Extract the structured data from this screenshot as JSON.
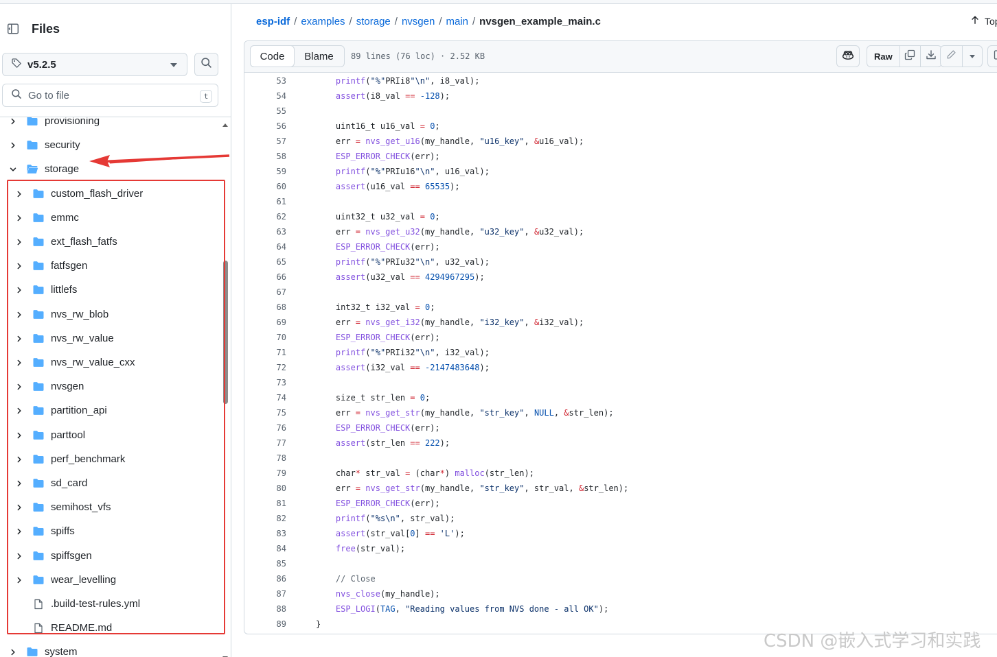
{
  "sidebar": {
    "title": "Files",
    "branch": "v5.2.5",
    "goto_placeholder": "Go to file",
    "goto_shortcut": "t",
    "tree": [
      {
        "label": "provisioning",
        "type": "folder",
        "expanded": false,
        "depth": 0
      },
      {
        "label": "security",
        "type": "folder",
        "expanded": false,
        "depth": 0
      },
      {
        "label": "storage",
        "type": "folder",
        "expanded": true,
        "depth": 0
      },
      {
        "label": "custom_flash_driver",
        "type": "folder",
        "expanded": false,
        "depth": 1
      },
      {
        "label": "emmc",
        "type": "folder",
        "expanded": false,
        "depth": 1
      },
      {
        "label": "ext_flash_fatfs",
        "type": "folder",
        "expanded": false,
        "depth": 1
      },
      {
        "label": "fatfsgen",
        "type": "folder",
        "expanded": false,
        "depth": 1
      },
      {
        "label": "littlefs",
        "type": "folder",
        "expanded": false,
        "depth": 1
      },
      {
        "label": "nvs_rw_blob",
        "type": "folder",
        "expanded": false,
        "depth": 1
      },
      {
        "label": "nvs_rw_value",
        "type": "folder",
        "expanded": false,
        "depth": 1
      },
      {
        "label": "nvs_rw_value_cxx",
        "type": "folder",
        "expanded": false,
        "depth": 1
      },
      {
        "label": "nvsgen",
        "type": "folder",
        "expanded": false,
        "depth": 1
      },
      {
        "label": "partition_api",
        "type": "folder",
        "expanded": false,
        "depth": 1
      },
      {
        "label": "parttool",
        "type": "folder",
        "expanded": false,
        "depth": 1
      },
      {
        "label": "perf_benchmark",
        "type": "folder",
        "expanded": false,
        "depth": 1
      },
      {
        "label": "sd_card",
        "type": "folder",
        "expanded": false,
        "depth": 1
      },
      {
        "label": "semihost_vfs",
        "type": "folder",
        "expanded": false,
        "depth": 1
      },
      {
        "label": "spiffs",
        "type": "folder",
        "expanded": false,
        "depth": 1
      },
      {
        "label": "spiffsgen",
        "type": "folder",
        "expanded": false,
        "depth": 1
      },
      {
        "label": "wear_levelling",
        "type": "folder",
        "expanded": false,
        "depth": 1
      },
      {
        "label": ".build-test-rules.yml",
        "type": "file",
        "depth": 1
      },
      {
        "label": "README.md",
        "type": "file",
        "depth": 1
      },
      {
        "label": "system",
        "type": "folder",
        "expanded": false,
        "depth": 0
      }
    ]
  },
  "breadcrumb": {
    "parts": [
      "esp-idf",
      "examples",
      "storage",
      "nvsgen",
      "main"
    ],
    "separator": "/",
    "current": "nvsgen_example_main.c"
  },
  "top_label": "Top",
  "viewer": {
    "tabs": [
      "Code",
      "Blame"
    ],
    "active_tab": "Code",
    "meta": "89 lines (76 loc) · 2.52 KB",
    "raw_label": "Raw"
  },
  "code_lines": [
    {
      "n": "53",
      "t": "    printf(\"%\"PRIi8\"\\n\", i8_val);"
    },
    {
      "n": "54",
      "t": "    assert(i8_val == -128);"
    },
    {
      "n": "55",
      "t": ""
    },
    {
      "n": "56",
      "t": "    uint16_t u16_val = 0;"
    },
    {
      "n": "57",
      "t": "    err = nvs_get_u16(my_handle, \"u16_key\", &u16_val);"
    },
    {
      "n": "58",
      "t": "    ESP_ERROR_CHECK(err);"
    },
    {
      "n": "59",
      "t": "    printf(\"%\"PRIu16\"\\n\", u16_val);"
    },
    {
      "n": "60",
      "t": "    assert(u16_val == 65535);"
    },
    {
      "n": "61",
      "t": ""
    },
    {
      "n": "62",
      "t": "    uint32_t u32_val = 0;"
    },
    {
      "n": "63",
      "t": "    err = nvs_get_u32(my_handle, \"u32_key\", &u32_val);"
    },
    {
      "n": "64",
      "t": "    ESP_ERROR_CHECK(err);"
    },
    {
      "n": "65",
      "t": "    printf(\"%\"PRIu32\"\\n\", u32_val);"
    },
    {
      "n": "66",
      "t": "    assert(u32_val == 4294967295);"
    },
    {
      "n": "67",
      "t": ""
    },
    {
      "n": "68",
      "t": "    int32_t i32_val = 0;"
    },
    {
      "n": "69",
      "t": "    err = nvs_get_i32(my_handle, \"i32_key\", &i32_val);"
    },
    {
      "n": "70",
      "t": "    ESP_ERROR_CHECK(err);"
    },
    {
      "n": "71",
      "t": "    printf(\"%\"PRIi32\"\\n\", i32_val);"
    },
    {
      "n": "72",
      "t": "    assert(i32_val == -2147483648);"
    },
    {
      "n": "73",
      "t": ""
    },
    {
      "n": "74",
      "t": "    size_t str_len = 0;"
    },
    {
      "n": "75",
      "t": "    err = nvs_get_str(my_handle, \"str_key\", NULL, &str_len);"
    },
    {
      "n": "76",
      "t": "    ESP_ERROR_CHECK(err);"
    },
    {
      "n": "77",
      "t": "    assert(str_len == 222);"
    },
    {
      "n": "78",
      "t": ""
    },
    {
      "n": "79",
      "t": "    char* str_val = (char*) malloc(str_len);"
    },
    {
      "n": "80",
      "t": "    err = nvs_get_str(my_handle, \"str_key\", str_val, &str_len);"
    },
    {
      "n": "81",
      "t": "    ESP_ERROR_CHECK(err);"
    },
    {
      "n": "82",
      "t": "    printf(\"%s\\n\", str_val);"
    },
    {
      "n": "83",
      "t": "    assert(str_val[0] == 'L');"
    },
    {
      "n": "84",
      "t": "    free(str_val);"
    },
    {
      "n": "85",
      "t": ""
    },
    {
      "n": "86",
      "t": "    // Close"
    },
    {
      "n": "87",
      "t": "    nvs_close(my_handle);"
    },
    {
      "n": "88",
      "t": "    ESP_LOGI(TAG, \"Reading values from NVS done - all OK\");"
    },
    {
      "n": "89",
      "t": "}"
    }
  ],
  "watermark": "CSDN @嵌入式学习和实践",
  "colors": {
    "annotation_red": "#e53935",
    "link_blue": "#0969da",
    "folder_blue": "#54aeff",
    "string": "#0a3069",
    "function": "#8250df",
    "number": "#0550ae"
  },
  "icons": {
    "panel": "sidebar-collapse-icon",
    "branch": "tag-icon",
    "search": "search-icon",
    "folder": "folder-icon",
    "file": "file-icon",
    "copilot": "copilot-icon",
    "copy": "copy-icon",
    "download": "download-icon",
    "edit": "pencil-icon",
    "symbols": "code-square-icon"
  }
}
